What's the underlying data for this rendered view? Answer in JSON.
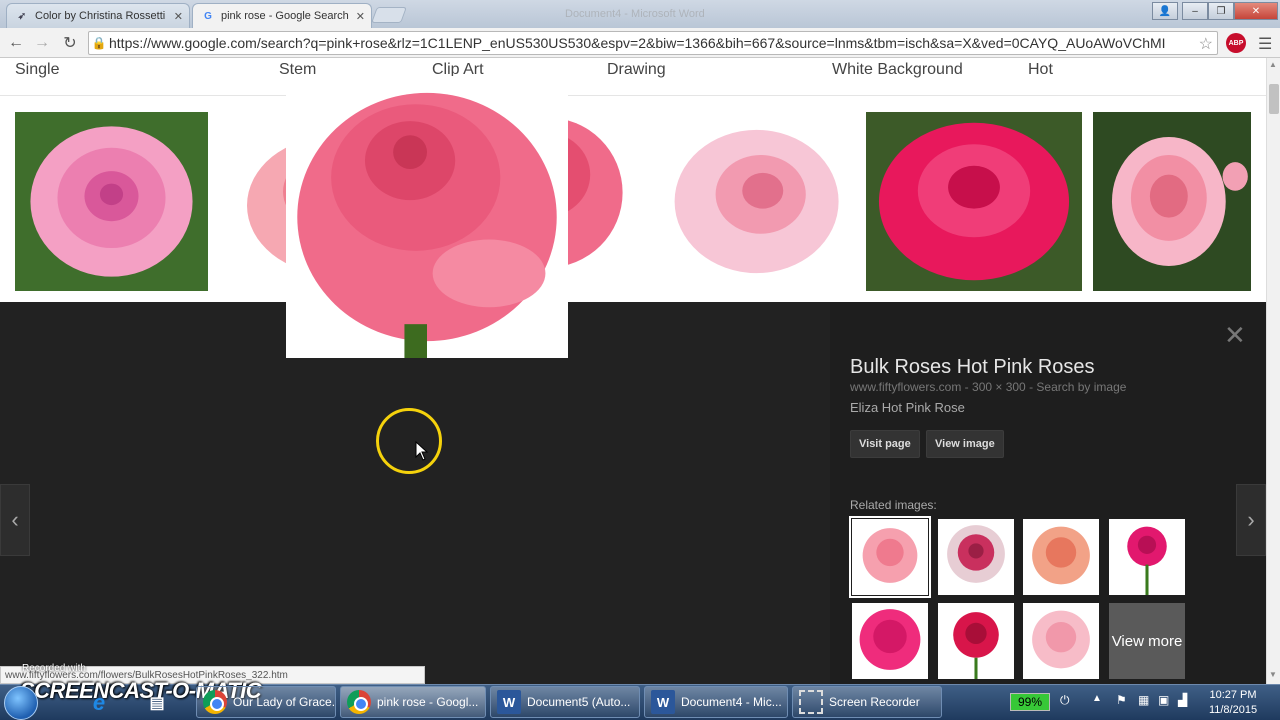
{
  "browser": {
    "tabs": [
      {
        "title": "Color by Christina Rossetti",
        "active": false
      },
      {
        "title": "pink rose - Google Search",
        "active": true
      }
    ],
    "background_window_title": "Document4 - Microsoft Word",
    "url": "https://www.google.com/search?q=pink+rose&rlz=1C1LENP_enUS530US530&espv=2&biw=1366&bih=667&source=lnms&tbm=isch&sa=X&ved=0CAYQ_AUoAWoVChMI",
    "abp_label": "ABP"
  },
  "filters": [
    "Single",
    "Stem",
    "Clip Art",
    "Drawing",
    "White Background",
    "Hot"
  ],
  "colors": {
    "panel_bg": "#222222",
    "rose_pink": "#f06b8a",
    "hot_pink": "#e8185c",
    "light_pink": "#f7b6c8",
    "cursor_ring": "#f5d20c"
  },
  "preview": {
    "title": "Bulk Roses Hot Pink Roses",
    "meta": "www.fiftyflowers.com - 300 × 300 - Search by image",
    "description": "Eliza Hot Pink Rose",
    "visit_label": "Visit page",
    "view_label": "View image",
    "related_label": "Related images:",
    "view_more_label": "View more"
  },
  "status_url": "www.fiftyflowers.com/flowers/BulkRosesHotPinkRoses_322.htm",
  "watermark": {
    "top": "Recorded with",
    "main": "SCREENCAST-O-MATIC"
  },
  "taskbar": {
    "items": [
      {
        "label": "Our Lady of Grace...",
        "icon": "chrome-icon"
      },
      {
        "label": "pink rose - Googl...",
        "icon": "chrome-icon"
      },
      {
        "label": "Document5 (Auto...",
        "icon": "word-icon"
      },
      {
        "label": "Document4 - Mic...",
        "icon": "word-icon"
      },
      {
        "label": "Screen Recorder",
        "icon": "recorder-icon"
      }
    ],
    "battery": "99%",
    "time": "10:27 PM",
    "date": "11/8/2015"
  }
}
